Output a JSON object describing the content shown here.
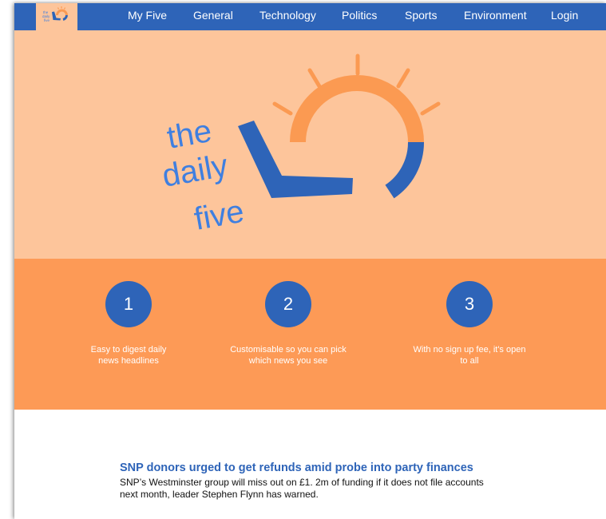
{
  "nav": {
    "logo_icon": "daily-five-logo",
    "items": [
      {
        "label": "My Five"
      },
      {
        "label": "General"
      },
      {
        "label": "Technology"
      },
      {
        "label": "Politics"
      },
      {
        "label": "Sports"
      },
      {
        "label": "Environment"
      },
      {
        "label": "Login"
      }
    ]
  },
  "hero": {
    "logo_words": [
      "the",
      "daily",
      "five"
    ],
    "logo_icon": "sun-five-logo"
  },
  "features": [
    {
      "number": "1",
      "text": "Easy to digest daily news headlines"
    },
    {
      "number": "2",
      "text": "Customisable so you can pick which news you see"
    },
    {
      "number": "3",
      "text": "With no sign up fee, it's open to all"
    }
  ],
  "article": {
    "title": "SNP donors urged to get refunds amid probe into party finances",
    "summary": "SNP’s Westminster group will miss out on £1. 2m of funding if it does not file accounts next month, leader Stephen Flynn has warned."
  },
  "colors": {
    "blue": "#2e64b8",
    "peach": "#fdc59b",
    "orange": "#fd9a56",
    "logo_orange": "#fb9a52",
    "logo_text": "#3f7fe0"
  }
}
